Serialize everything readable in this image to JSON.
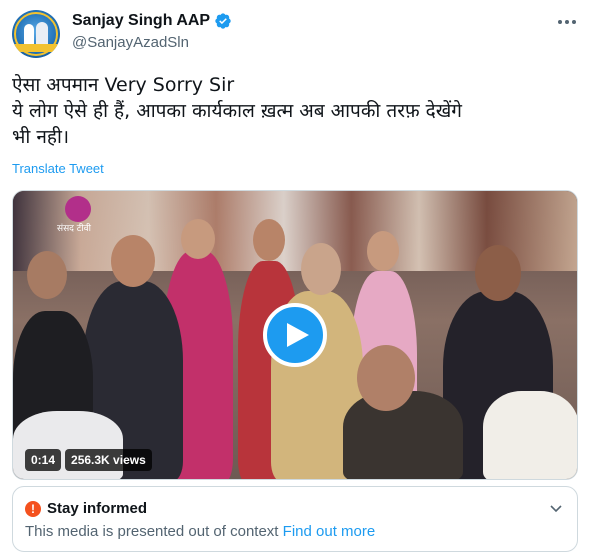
{
  "author": {
    "display_name": "Sanjay Singh AAP",
    "handle": "@SanjayAzadSln"
  },
  "tweet": {
    "line1": "ऐसा अपमान Very Sorry Sir",
    "line2": "ये लोग ऐसे ही हैं, आपका कार्यकाल ख़त्म अब आपकी तरफ़ देखेंगे",
    "line3": "भी नही।",
    "translate_label": "Translate Tweet"
  },
  "video": {
    "duration": "0:14",
    "views": "256.3K views",
    "channel_logo_text": "संसद टीवी"
  },
  "notice": {
    "title": "Stay informed",
    "body": "This media is presented out of context",
    "link": "Find out more"
  },
  "icons": {
    "verified": "verified-badge-icon",
    "more": "more-options-icon",
    "play": "play-icon",
    "warning": "warning-icon",
    "chevron": "chevron-down-icon"
  },
  "colors": {
    "accent": "#1d9bf0",
    "text_primary": "#0f1419",
    "text_secondary": "#536471",
    "warning": "#f4511e"
  }
}
